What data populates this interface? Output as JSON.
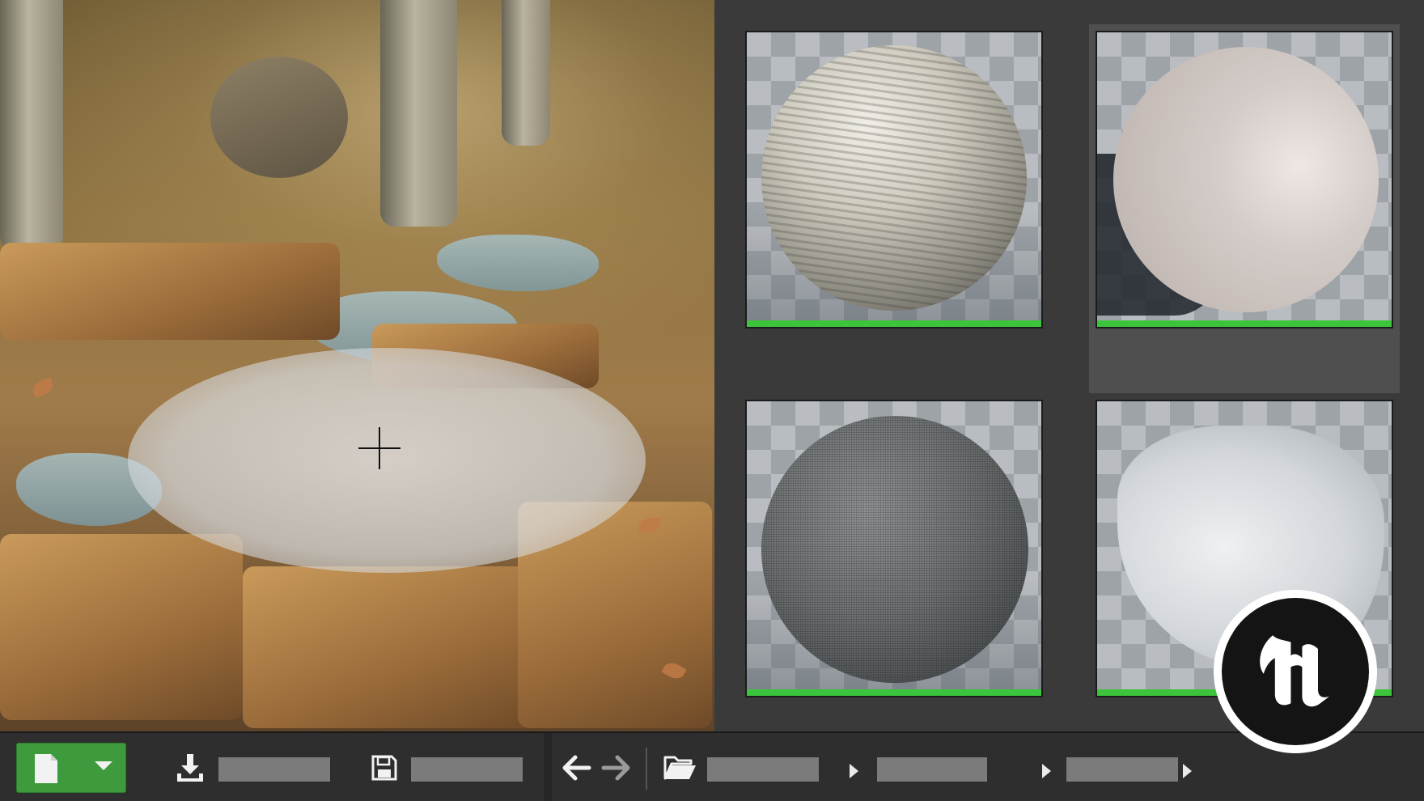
{
  "toolbar": {
    "import_label": "",
    "save_label": "",
    "breadcrumbs": [
      "",
      "",
      ""
    ]
  },
  "assets": [
    {
      "name": "",
      "selected": false
    },
    {
      "name": "",
      "selected": true
    },
    {
      "name": "",
      "selected": false
    },
    {
      "name": "",
      "selected": false
    }
  ],
  "colors": {
    "accent_green": "#3cc43c",
    "new_button_green": "#3d9a3d",
    "panel_background": "#3a3a3a",
    "toolbar_background": "#2e2e2e",
    "label_box": "#7b7b7b"
  },
  "icons": {
    "new": "document-icon",
    "dropdown": "chevron-down-icon",
    "import": "download-icon",
    "save": "save-disk-icon",
    "back": "arrow-left-icon",
    "forward": "arrow-right-icon",
    "folder": "folder-open-icon",
    "breadcrumb_separator": "chevron-right-icon",
    "logo": "unreal-engine-logo"
  }
}
